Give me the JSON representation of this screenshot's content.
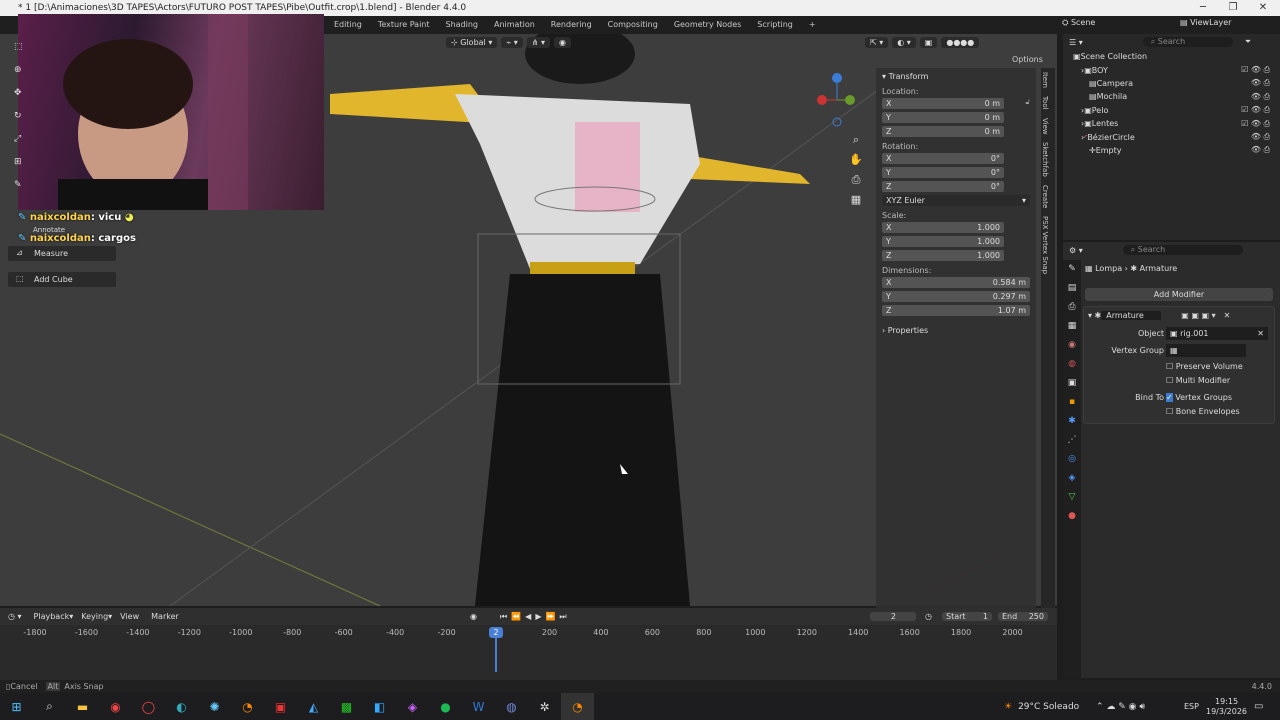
{
  "titlebar": {
    "title": "* 1 [D:\\Animaciones\\3D TAPES\\Actors\\FUTURO POST TAPES\\Pibe\\Outfit.crop\\1.blend] - Blender 4.4.0"
  },
  "workspaces": [
    "Editing",
    "Texture Paint",
    "Shading",
    "Animation",
    "Rendering",
    "Compositing",
    "Geometry Nodes",
    "Scripting"
  ],
  "topright": {
    "scene": "Scene",
    "viewlayer": "ViewLayer"
  },
  "viewport_header": {
    "orientation": "Global",
    "options": "Options"
  },
  "chat": [
    {
      "user": "naixcoldan",
      "msg": "vicu"
    },
    {
      "user": "naixcoldan",
      "msg": "cargos"
    }
  ],
  "tools": {
    "annotate": "Annotate",
    "measure": "Measure",
    "add_cube": "Add Cube"
  },
  "npanel": {
    "transform": "Transform",
    "location_label": "Location:",
    "location": [
      {
        "axis": "X",
        "value": "0 m"
      },
      {
        "axis": "Y",
        "value": "0 m"
      },
      {
        "axis": "Z",
        "value": "0 m"
      }
    ],
    "rotation_label": "Rotation:",
    "rotation": [
      {
        "axis": "X",
        "value": "0°"
      },
      {
        "axis": "Y",
        "value": "0°"
      },
      {
        "axis": "Z",
        "value": "0°"
      }
    ],
    "rotation_mode": "XYZ Euler",
    "scale_label": "Scale:",
    "scale": [
      {
        "axis": "X",
        "value": "1.000"
      },
      {
        "axis": "Y",
        "value": "1.000"
      },
      {
        "axis": "Z",
        "value": "1.000"
      }
    ],
    "dimensions_label": "Dimensions:",
    "dimensions": [
      {
        "axis": "X",
        "value": "0.584 m"
      },
      {
        "axis": "Y",
        "value": "0.297 m"
      },
      {
        "axis": "Z",
        "value": "1.07 m"
      }
    ],
    "properties": "Properties"
  },
  "sidetabs": [
    "Item",
    "Tool",
    "View",
    "Sketchfab",
    "Create",
    "PSX Vertex Snap"
  ],
  "outliner": {
    "search": "Search",
    "root": "Scene Collection",
    "items": [
      "BOY",
      "Campera",
      "Mochila",
      "Pelo",
      "Lentes",
      "BézierCircle",
      "Empty"
    ]
  },
  "properties": {
    "search": "Search",
    "breadcrumb_obj": "Lompa",
    "breadcrumb_mod": "Armature",
    "add_modifier": "Add Modifier",
    "modifier_name": "Armature",
    "object_label": "Object",
    "object_value": "rig.001",
    "vgroup_label": "Vertex Group",
    "preserve_volume": "Preserve Volume",
    "multi_modifier": "Multi Modifier",
    "bind_to_label": "Bind To",
    "vertex_groups": "Vertex Groups",
    "bone_envelopes": "Bone Envelopes"
  },
  "timeline": {
    "menus": [
      "Playback",
      "Keying",
      "View",
      "Marker"
    ],
    "current_frame": "2",
    "start_label": "Start",
    "start": "1",
    "end_label": "End",
    "end": "250",
    "ruler": [
      "-1800",
      "-1600",
      "-1400",
      "-1200",
      "-1000",
      "-800",
      "-600",
      "-400",
      "-200",
      "2",
      "200",
      "400",
      "600",
      "800",
      "1000",
      "1200",
      "1400",
      "1600",
      "1800",
      "2000"
    ]
  },
  "statusbar": {
    "cancel": "Cancel",
    "alt": "Alt",
    "axis_snap": "Axis Snap",
    "version": "4.4.0"
  },
  "taskbar": {
    "weather": "29°C Soleado",
    "lang": "ESP",
    "time": "19:15",
    "date": "19/3/2026"
  }
}
